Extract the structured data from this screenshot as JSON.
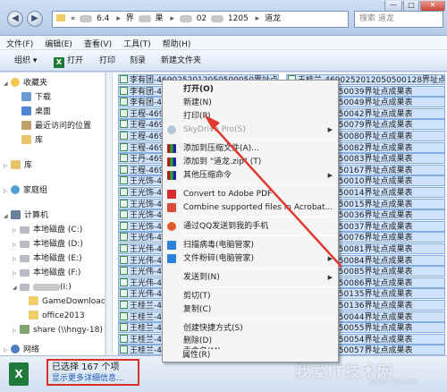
{
  "window": {
    "address_path": [
      "«",
      "6.4",
      "界",
      "果",
      "02",
      "1205",
      "道龙"
    ],
    "search_placeholder": "搜索 道龙",
    "controls": [
      "—",
      "□",
      "✕"
    ]
  },
  "menubar": [
    "文件(F)",
    "编辑(E)",
    "查看(V)",
    "工具(T)",
    "帮助(H)"
  ],
  "toolbar": {
    "organize": "组织 ▾",
    "open": "打开",
    "print": "打印",
    "burn": "刻录",
    "new_folder": "新建文件夹"
  },
  "nav": {
    "favorites": "收藏夹",
    "downloads": "下载",
    "desktop": "桌面",
    "recent": "最近访问的位置",
    "library": "库",
    "library2": "库",
    "homegroup": "家庭组",
    "computer": "计算机",
    "disks": [
      "本地磁盘 (C:)",
      "本地磁盘 (D:)",
      "本地磁盘 (E:)",
      "本地磁盘 (F:)"
    ],
    "removable": "(I:)",
    "folders": [
      "GameDownload",
      "office2013"
    ],
    "share": "share (\\\\hngy-18) (",
    "network": "网络"
  },
  "files": {
    "left_column": [
      "李有团-4690252012050500050界址点成果表",
      "李有团-46",
      "李有团-46",
      "王程-469",
      "王程-469",
      "王程-469",
      "王程-469",
      "王丹-469",
      "王程-469",
      "王光饰-46",
      "王光饰-46",
      "王光饰-46",
      "王光饰-46",
      "王光饰-46",
      "王光伟-46",
      "王光伟-46",
      "王光伟-46",
      "王光伟-46",
      "王光伟-46",
      "王光伟-46",
      "王桂兰-46",
      "王桂兰-46",
      "王桂兰-46",
      "王桂兰-46",
      "王桂兰-46"
    ],
    "right_column": [
      "王桂兰-4690252012050500128界址点成果表",
      "5201205050039界址点成果表",
      "5201205050049界址点成果表",
      "5201205050042界址点成果表",
      "5201205050079界址点成果表",
      "5201205050080界址点成果表",
      "5201205050082界址点成果表",
      "5201205050083界址点成果表",
      "5201205050167界址点成果表",
      "5201205050010界址点成果表",
      "5201205050014界址点成果表",
      "5201205050015界址点成果表",
      "5201205050036界址点成果表",
      "5201205050037界址点成果表",
      "5201205050076界址点成果表",
      "5201205050081界址点成果表",
      "5201205050084界址点成果表",
      "5201205050085界址点成果表",
      "5201205050086界址点成果表",
      "5201205050135界址点成果表",
      "5201205050136界址点成果表",
      "5201205050044界址点成果表",
      "5201205050055界址点成果表",
      "5201205050054界址点成果表",
      "5201205050057界址点成果表"
    ]
  },
  "context_menu": {
    "open": "打开(O)",
    "new": "新建(N)",
    "print": "打印(P)",
    "skydrive": "SkyDrive Pro(S)",
    "add_archive": "添加到压缩文件(A)...",
    "add_zip": "添加到 \"道龙.zip\" (T)",
    "other_zip": "其他压缩命令",
    "convert_pdf": "Convert to Adobe PDF",
    "combine_pdf": "Combine supported files in Acrobat...",
    "send_qq": "通过QQ发送到我的手机",
    "scan_virus": "扫描病毒(电脑管家)",
    "shred": "文件粉碎(电脑管家)",
    "send_to": "发送到(N)",
    "cut": "剪切(T)",
    "copy": "复制(C)",
    "create_shortcut": "创建快捷方式(S)",
    "delete": "删除(D)",
    "rename": "重命名(M)",
    "properties": "属性(R)"
  },
  "status": {
    "selected": "已选择 167 个项",
    "more_details": "显示更多详细信息...",
    "watermark": "我爱IT技术网",
    "watermark_url": "www.52ij.com"
  },
  "colors": {
    "highlight_red": "#d8302a",
    "selection_blue": "#cfe3fc"
  }
}
